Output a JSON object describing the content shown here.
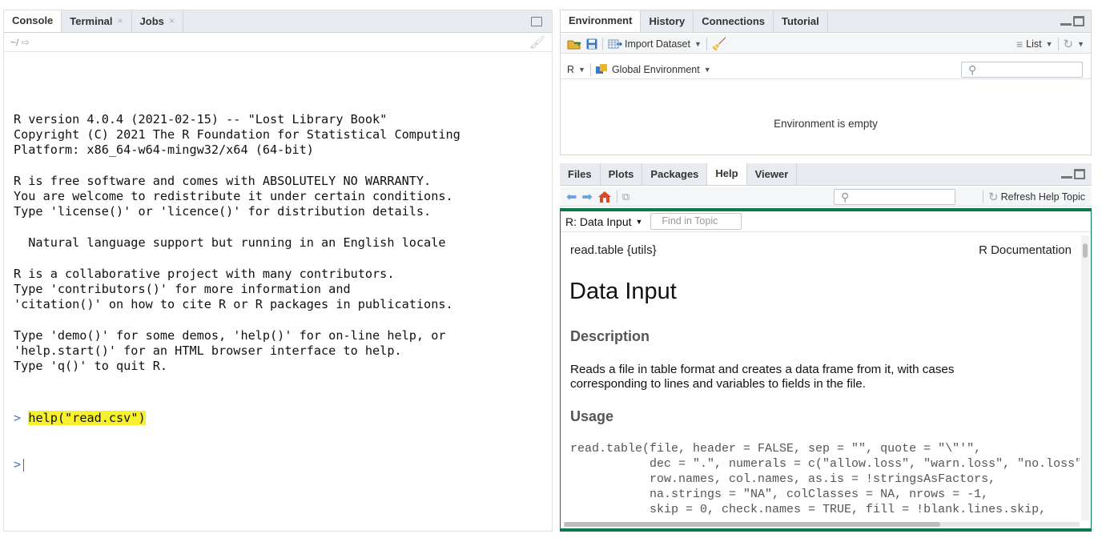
{
  "console_pane": {
    "tabs": [
      {
        "label": "Console",
        "closable": false,
        "active": true
      },
      {
        "label": "Terminal",
        "closable": true,
        "active": false
      },
      {
        "label": "Jobs",
        "closable": true,
        "active": false
      }
    ],
    "path": "~/",
    "lines": [
      "R version 4.0.4 (2021-02-15) -- \"Lost Library Book\"",
      "Copyright (C) 2021 The R Foundation for Statistical Computing",
      "Platform: x86_64-w64-mingw32/x64 (64-bit)",
      "",
      "R is free software and comes with ABSOLUTELY NO WARRANTY.",
      "You are welcome to redistribute it under certain conditions.",
      "Type 'license()' or 'licence()' for distribution details.",
      "",
      "  Natural language support but running in an English locale",
      "",
      "R is a collaborative project with many contributors.",
      "Type 'contributors()' for more information and",
      "'citation()' on how to cite R or R packages in publications.",
      "",
      "Type 'demo()' for some demos, 'help()' for on-line help, or",
      "'help.start()' for an HTML browser interface to help.",
      "Type 'q()' to quit R."
    ],
    "prompt_symbol": ">",
    "command": "help(\"read.csv\")",
    "highlight_color": "#f7f02e"
  },
  "env_pane": {
    "tabs": [
      {
        "label": "Environment",
        "active": true
      },
      {
        "label": "History",
        "active": false
      },
      {
        "label": "Connections",
        "active": false
      },
      {
        "label": "Tutorial",
        "active": false
      }
    ],
    "toolbar": {
      "import_label": "Import Dataset",
      "view_label": "List"
    },
    "language": "R",
    "scope": "Global Environment",
    "empty_message": "Environment is empty"
  },
  "help_pane": {
    "tabs": [
      {
        "label": "Files",
        "active": false
      },
      {
        "label": "Plots",
        "active": false
      },
      {
        "label": "Packages",
        "active": false
      },
      {
        "label": "Help",
        "active": true
      },
      {
        "label": "Viewer",
        "active": false
      }
    ],
    "refresh_label": "Refresh Help Topic",
    "topic": "R: Data Input",
    "find_placeholder": "Find in Topic",
    "doc": {
      "package_ref": "read.table {utils}",
      "doc_label": "R Documentation",
      "title": "Data Input",
      "description_heading": "Description",
      "description_text": "Reads a file in table format and creates a data frame from it, with cases corresponding to lines and variables to fields in the file.",
      "usage_heading": "Usage",
      "usage_code": [
        "read.table(file, header = FALSE, sep = \"\", quote = \"\\\"'\",",
        "           dec = \".\", numerals = c(\"allow.loss\", \"warn.loss\", \"no.loss\"),",
        "           row.names, col.names, as.is = !stringsAsFactors,",
        "           na.strings = \"NA\", colClasses = NA, nrows = -1,",
        "           skip = 0, check.names = TRUE, fill = !blank.lines.skip,"
      ]
    },
    "highlight_border_color": "#0c7a4a"
  }
}
